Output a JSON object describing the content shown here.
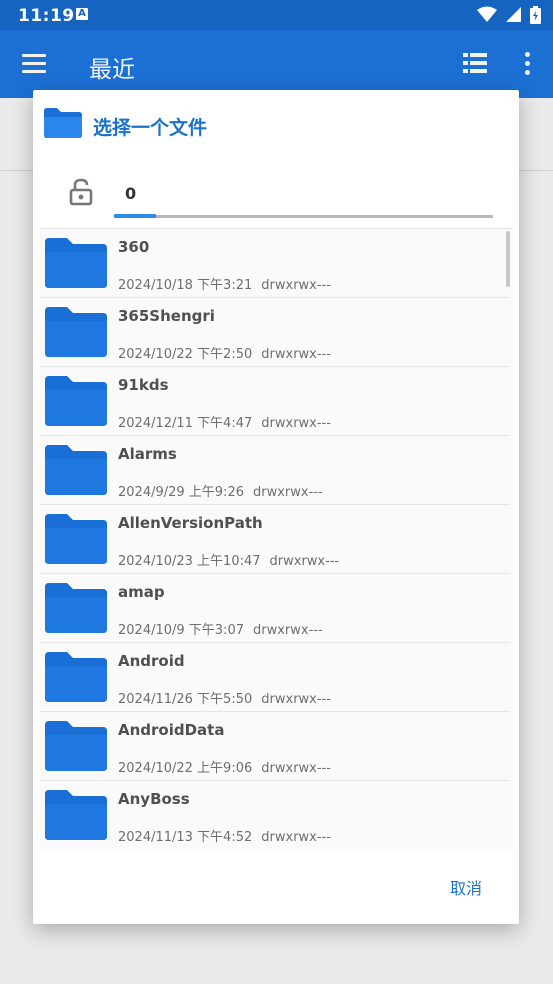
{
  "status_bar": {
    "time": "11:19",
    "badge": "A"
  },
  "toolbar": {
    "title": "最近",
    "icons": [
      "menu-icon",
      "list-view-icon",
      "more-vert-icon"
    ]
  },
  "dialog": {
    "title": "选择一个文件",
    "path_crumb": "0",
    "cancel_label": "取消",
    "files": [
      {
        "name": "360",
        "date": "2024/10/18 下午3:21",
        "perm": "drwxrwx---"
      },
      {
        "name": "365Shengri",
        "date": "2024/10/22 下午2:50",
        "perm": "drwxrwx---"
      },
      {
        "name": "91kds",
        "date": "2024/12/11 下午4:47",
        "perm": "drwxrwx---"
      },
      {
        "name": "Alarms",
        "date": "2024/9/29 上午9:26",
        "perm": "drwxrwx---"
      },
      {
        "name": "AllenVersionPath",
        "date": "2024/10/23 上午10:47",
        "perm": "drwxrwx---"
      },
      {
        "name": "amap",
        "date": "2024/10/9 下午3:07",
        "perm": "drwxrwx---"
      },
      {
        "name": "Android",
        "date": "2024/11/26 下午5:50",
        "perm": "drwxrwx---"
      },
      {
        "name": "AndroidData",
        "date": "2024/10/22 上午9:06",
        "perm": "drwxrwx---"
      },
      {
        "name": "AnyBoss",
        "date": "2024/11/13 下午4:52",
        "perm": "drwxrwx---"
      }
    ]
  },
  "colors": {
    "primary": "#1e76e0",
    "status_bar": "#1565c0",
    "accent": "#1a73c8",
    "folder": "#1a6fd6"
  }
}
